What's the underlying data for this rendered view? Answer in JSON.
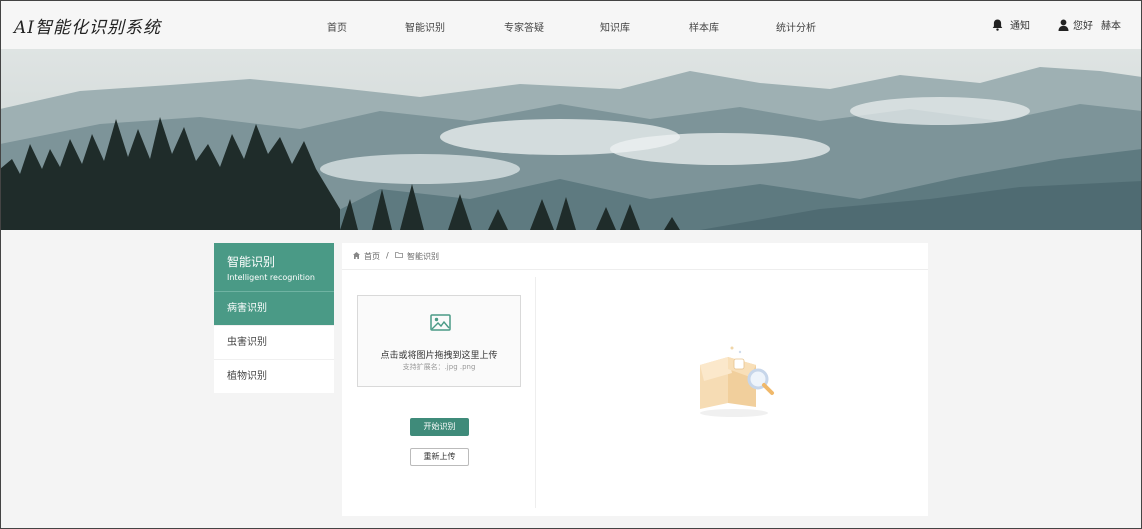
{
  "app": {
    "logo": "AI智能化识别系统"
  },
  "nav": {
    "items": [
      {
        "label": "首页"
      },
      {
        "label": "智能识别"
      },
      {
        "label": "专家答疑"
      },
      {
        "label": "知识库"
      },
      {
        "label": "样本库"
      },
      {
        "label": "统计分析"
      }
    ]
  },
  "header": {
    "notify_label": "通知",
    "greeting": "您好",
    "username": "赫本",
    "notify_icon": "bell-icon",
    "user_icon": "user-icon"
  },
  "sidebar": {
    "title": "智能识别",
    "subtitle": "Intelligent recognition",
    "items": [
      {
        "label": "病害识别",
        "active": true
      },
      {
        "label": "虫害识别",
        "active": false
      },
      {
        "label": "植物识别",
        "active": false
      }
    ]
  },
  "breadcrumb": {
    "home_icon": "home-icon",
    "home": "首页",
    "separator": "/",
    "folder_icon": "folder-icon",
    "current": "智能识别"
  },
  "upload": {
    "icon": "image-icon",
    "main_text": "点击或将图片拖拽到这里上传",
    "hint_text": "支持扩展名：.jpg .png"
  },
  "actions": {
    "start_label": "开始识别",
    "reupload_label": "重新上传"
  },
  "result": {
    "empty_icon": "empty-box-icon"
  },
  "colors": {
    "accent": "#4a9a86",
    "button": "#3f8b7a",
    "header_bg": "#f6f6f6",
    "page_bg": "#f4f4f4"
  }
}
